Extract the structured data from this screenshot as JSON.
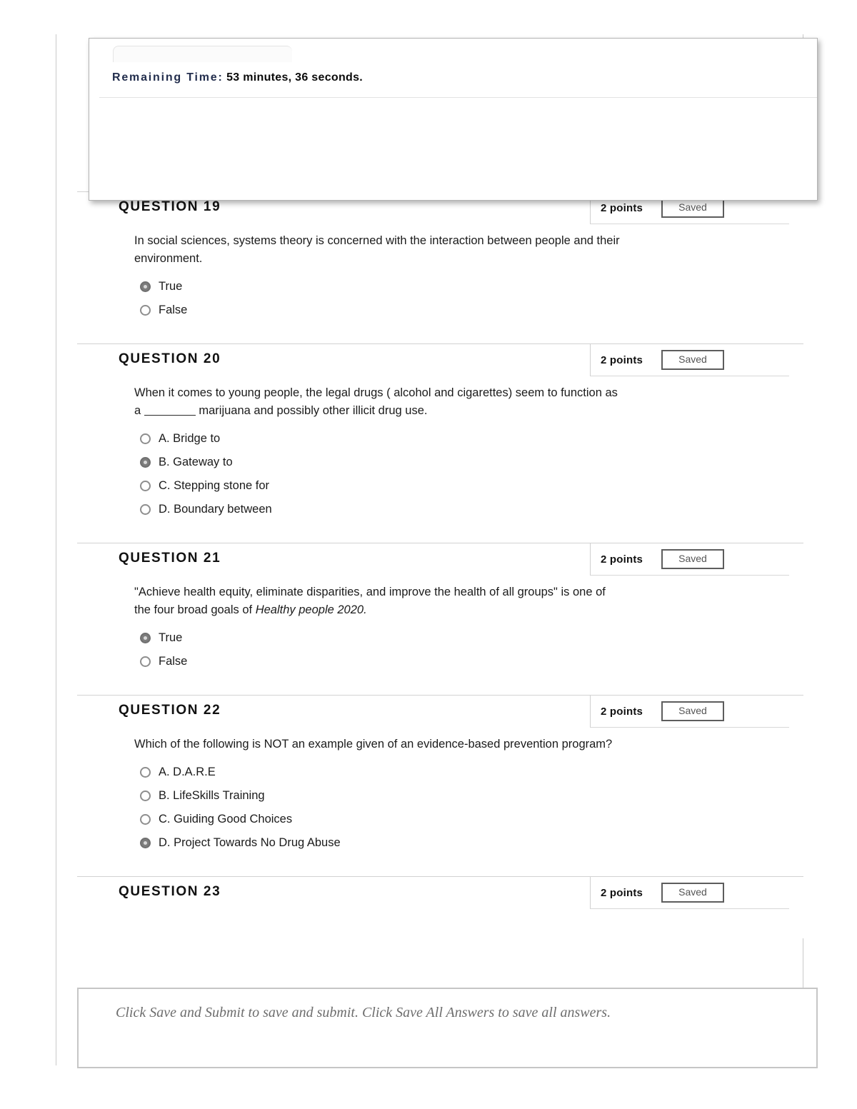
{
  "timer": {
    "label": "Remaining Time:",
    "value": "53 minutes, 36 seconds."
  },
  "footer": {
    "message": "Click Save and Submit to save and submit. Click Save All Answers to save all answers."
  },
  "questions": [
    {
      "title": "QUESTION 19",
      "points": "2 points",
      "status": "Saved",
      "text_before": "In social sciences, systems theory is concerned with the interaction between people and their environment.",
      "text_after": "",
      "has_blank": false,
      "options": [
        {
          "label": "True",
          "selected": true
        },
        {
          "label": "False",
          "selected": false
        }
      ]
    },
    {
      "title": "QUESTION 20",
      "points": "2 points",
      "status": "Saved",
      "text_before": "When it comes to young people, the legal drugs ( alcohol and cigarettes) seem to function as a",
      "text_after": "marijuana and possibly other illicit drug use.",
      "has_blank": true,
      "options": [
        {
          "label": "A. Bridge to",
          "selected": false
        },
        {
          "label": "B. Gateway to",
          "selected": true
        },
        {
          "label": "C. Stepping stone for",
          "selected": false
        },
        {
          "label": "D. Boundary between",
          "selected": false
        }
      ]
    },
    {
      "title": "QUESTION 21",
      "points": "2 points",
      "status": "Saved",
      "text_before": "\"Achieve health equity, eliminate disparities, and improve the health of all groups\" is one of the four broad goals of ",
      "text_italic": "Healthy people 2020.",
      "text_after": "",
      "has_blank": false,
      "options": [
        {
          "label": "True",
          "selected": true
        },
        {
          "label": "False",
          "selected": false
        }
      ]
    },
    {
      "title": "QUESTION 22",
      "points": "2 points",
      "status": "Saved",
      "text_before": "Which of the following is NOT  an example given of an evidence-based prevention program?",
      "text_after": "",
      "has_blank": false,
      "options": [
        {
          "label": "A. D.A.R.E",
          "selected": false
        },
        {
          "label": "B. LifeSkills Training",
          "selected": false
        },
        {
          "label": "C. Guiding Good Choices",
          "selected": false
        },
        {
          "label": "D. Project Towards No Drug Abuse",
          "selected": false,
          "selected_alt": true
        }
      ]
    },
    {
      "title": "QUESTION 23",
      "points": "2 points",
      "status": "Saved",
      "text_before": "",
      "text_after": "",
      "has_blank": false,
      "options": []
    }
  ]
}
